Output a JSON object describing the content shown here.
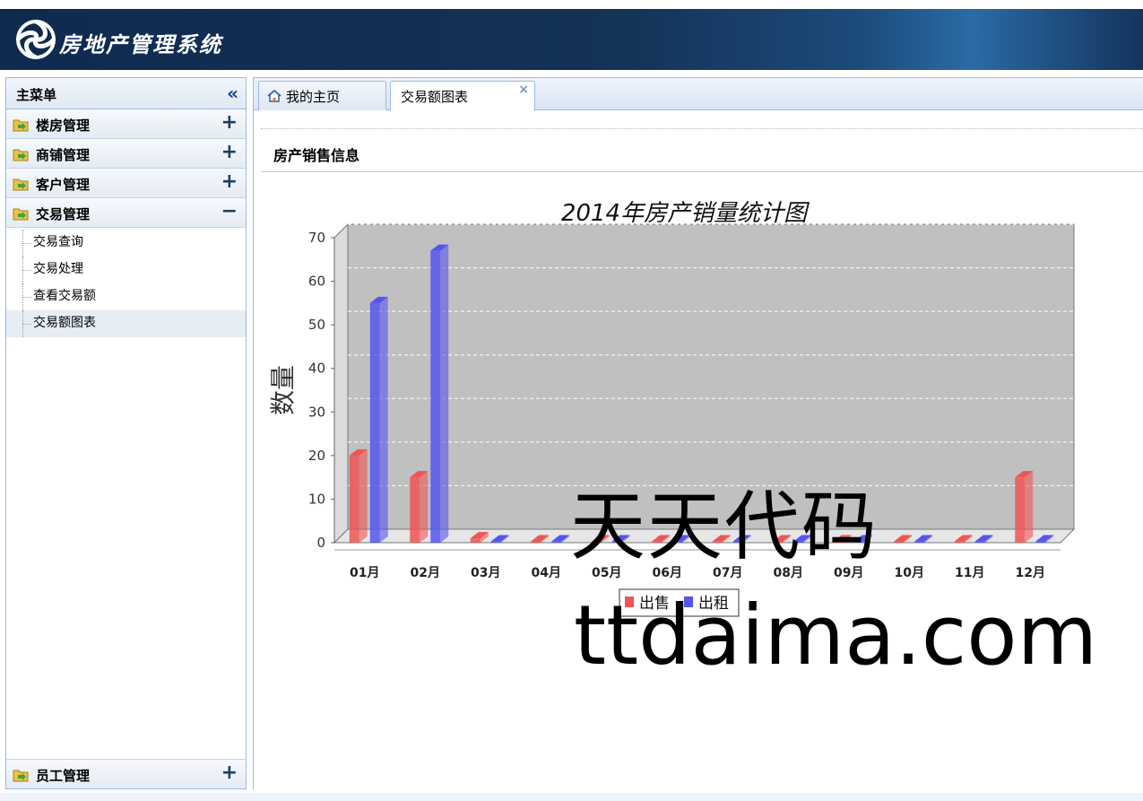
{
  "app": {
    "title": "房地产管理系统"
  },
  "sidebar": {
    "title": "主菜单",
    "collapse_glyph": "«",
    "groups": [
      {
        "label": "楼房管理",
        "toggle": "+"
      },
      {
        "label": "商铺管理",
        "toggle": "+"
      },
      {
        "label": "客户管理",
        "toggle": "+"
      },
      {
        "label": "交易管理",
        "toggle": "−"
      }
    ],
    "sub_items": [
      "交易查询",
      "交易处理",
      "查看交易额",
      "交易额图表"
    ],
    "bottom_group": {
      "label": "员工管理",
      "toggle": "+"
    }
  },
  "tabs": [
    {
      "label": "我的主页"
    },
    {
      "label": "交易额图表",
      "close": "×"
    }
  ],
  "section": {
    "title": "房产销售信息"
  },
  "chart_data": {
    "type": "bar",
    "title": "2014年房产销量统计图",
    "ylabel": "数量",
    "xlabel": "",
    "ylim": [
      0,
      70
    ],
    "yticks": [
      0,
      10,
      20,
      30,
      40,
      50,
      60,
      70
    ],
    "categories": [
      "01月",
      "02月",
      "03月",
      "04月",
      "05月",
      "06月",
      "07月",
      "08月",
      "09月",
      "10月",
      "11月",
      "12月"
    ],
    "series": [
      {
        "name": "出售",
        "color": "#ee5555",
        "values": [
          20,
          15,
          1,
          0,
          0,
          0,
          0,
          0,
          0,
          0,
          0,
          15
        ]
      },
      {
        "name": "出租",
        "color": "#5555ee",
        "values": [
          55,
          67,
          0,
          0,
          0,
          0,
          0,
          0,
          0,
          0,
          0,
          0
        ]
      }
    ],
    "grid": true,
    "legend": "bottom-center"
  },
  "watermark": {
    "cn": "天天代码",
    "en": "ttdaima.com"
  }
}
